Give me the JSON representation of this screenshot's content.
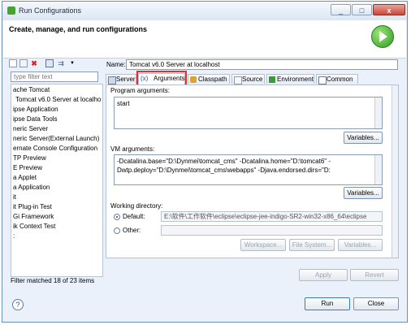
{
  "window": {
    "title": "Run Configurations",
    "minimize": "_",
    "maximize": "□",
    "close": "x"
  },
  "header": {
    "text": "Create, manage, and run configurations"
  },
  "left": {
    "filter_placeholder": "type filter text",
    "items": [
      "ache Tomcat",
      "Tomcat v6.0 Server at localho",
      "ipse Application",
      "ipse Data Tools",
      "neric Server",
      "neric Server(External Launch)",
      "ernate Console Configuration",
      "TP Preview",
      "E Preview",
      "a Applet",
      "a Application",
      "it",
      "it Plug-in Test",
      "Gi Framework",
      "ik Context Test",
      ":"
    ],
    "status": "Filter matched 18 of 23 items"
  },
  "right": {
    "name_label": "Name:",
    "name_value": "Tomcat v6.0 Server at localhost",
    "tabs": [
      "Server",
      "Arguments",
      "Classpath",
      "Source",
      "Environment",
      "Common"
    ],
    "program_args_label": "Program arguments:",
    "program_args_value": "start",
    "variables_1": "Variables...",
    "vm_args_label": "VM arguments:",
    "vm_args_line1": "-Dcatalina.base=\"D:\\Dynmei\\tomcat_cms\" -Dcatalina.home=\"D:\\tomcat6\" -",
    "vm_args_line2": "Dwtp.deploy=\"D:\\Dynmei\\tomcat_cms\\webapps\" -Djava.endorsed.dirs=\"D:",
    "variables_2": "Variables...",
    "working_dir_label": "Working directory:",
    "default_label": "Default:",
    "default_value": "E:\\软件\\工作软件\\eclipse\\eclipse-jee-indigo-SR2-win32-x86_64\\eclipse",
    "other_label": "Other:",
    "workspace_btn": "Workspace...",
    "filesystem_btn": "File System...",
    "variables_3": "Variables...",
    "apply_btn": "Apply",
    "revert_btn": "Revert"
  },
  "footer": {
    "help": "?",
    "run_btn": "Run",
    "close_btn": "Close"
  }
}
